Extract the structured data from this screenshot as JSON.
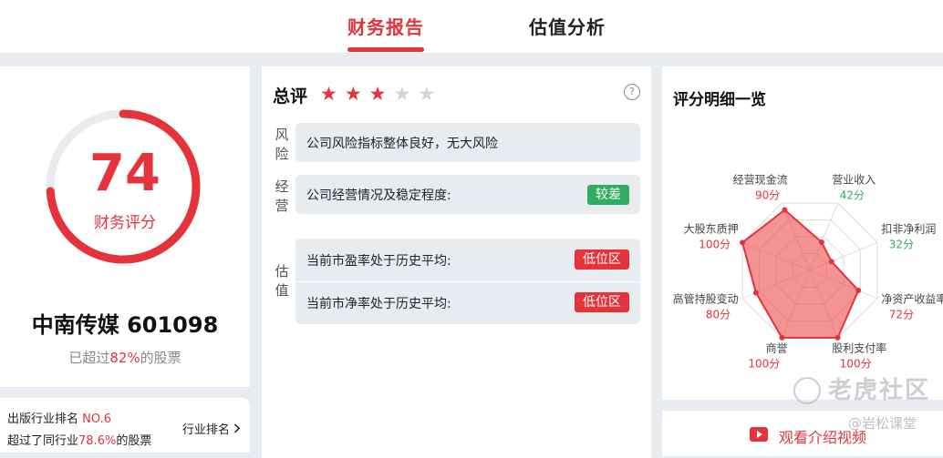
{
  "tabs": [
    {
      "label": "财务报告",
      "active": true
    },
    {
      "label": "估值分析",
      "active": false
    }
  ],
  "score": {
    "value": 74,
    "max": 100,
    "label": "财务评分"
  },
  "stock": {
    "name_code": "中南传媒 601098",
    "exceed_prefix": "已超过",
    "exceed_pct": "82%",
    "exceed_suffix": "的股票"
  },
  "industry": {
    "rank_prefix": "出版行业排名 ",
    "rank_value": "NO.6",
    "exceed_prefix": "超过了同行业",
    "exceed_pct": "78.6%",
    "exceed_suffix": "的股票",
    "link": "行业排名",
    "link_icon": "chevron-right-icon"
  },
  "overall": {
    "title": "总评",
    "stars_filled": 3,
    "stars_total": 5,
    "help_icon": "question-circle-icon",
    "help_glyph": "?"
  },
  "sections": {
    "risk": {
      "label": "风险",
      "text": "公司风险指标整体良好，无大风险"
    },
    "operation": {
      "label": "经营",
      "text": "公司经营情况及稳定程度:",
      "badge": "较差"
    },
    "valuation": {
      "label": "估值",
      "rows": [
        {
          "text": "当前市盈率处于历史平均:",
          "badge": "低位区"
        },
        {
          "text": "当前市净率处于历史平均:",
          "badge": "低位区"
        }
      ]
    }
  },
  "detail": {
    "title": "评分明细一览",
    "max": 100,
    "items": [
      {
        "name": "营业收入",
        "score": 42,
        "label": "42分",
        "color": "#2fae63"
      },
      {
        "name": "扣非净利润",
        "score": 32,
        "label": "32分",
        "color": "#2fae63"
      },
      {
        "name": "净资产收益率",
        "score": 72,
        "label": "72分",
        "color": "#e5333b"
      },
      {
        "name": "股利支付率",
        "score": 100,
        "label": "100分",
        "color": "#e5333b"
      },
      {
        "name": "商誉",
        "score": 100,
        "label": "100分",
        "color": "#e5333b"
      },
      {
        "name": "高管持股变动",
        "score": 80,
        "label": "80分",
        "color": "#e5333b"
      },
      {
        "name": "大股东质押",
        "score": 100,
        "label": "100分",
        "color": "#e5333b"
      },
      {
        "name": "经营现金流",
        "score": 90,
        "label": "90分",
        "color": "#e5333b"
      }
    ]
  },
  "video": {
    "label": "观看介绍视频",
    "icon": "play-video-icon"
  },
  "watermark": {
    "brand": "老虎社区",
    "sub": "@岩松课堂"
  },
  "colors": {
    "accent": "#e5333b",
    "good": "#2fae63"
  }
}
